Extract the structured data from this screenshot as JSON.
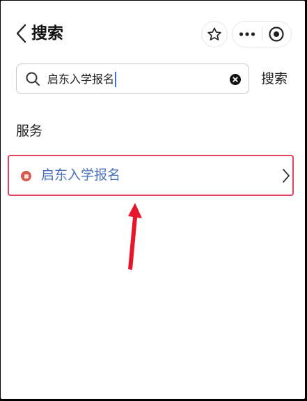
{
  "header": {
    "back_icon": "chevron-left-icon",
    "title": "搜索",
    "favorite_icon": "star-outline-icon",
    "more_icon": "more-dots-icon",
    "close_icon": "target-circle-icon"
  },
  "search": {
    "query": "启东入学报名",
    "button_label": "搜索"
  },
  "results": {
    "section_title": "服务",
    "items": [
      {
        "label": "启东入学报名"
      }
    ]
  },
  "colors": {
    "highlight_border": "#e2435a",
    "result_link": "#4a6fbf",
    "annotation_arrow": "#e8162a",
    "caret": "#3b6cff"
  }
}
